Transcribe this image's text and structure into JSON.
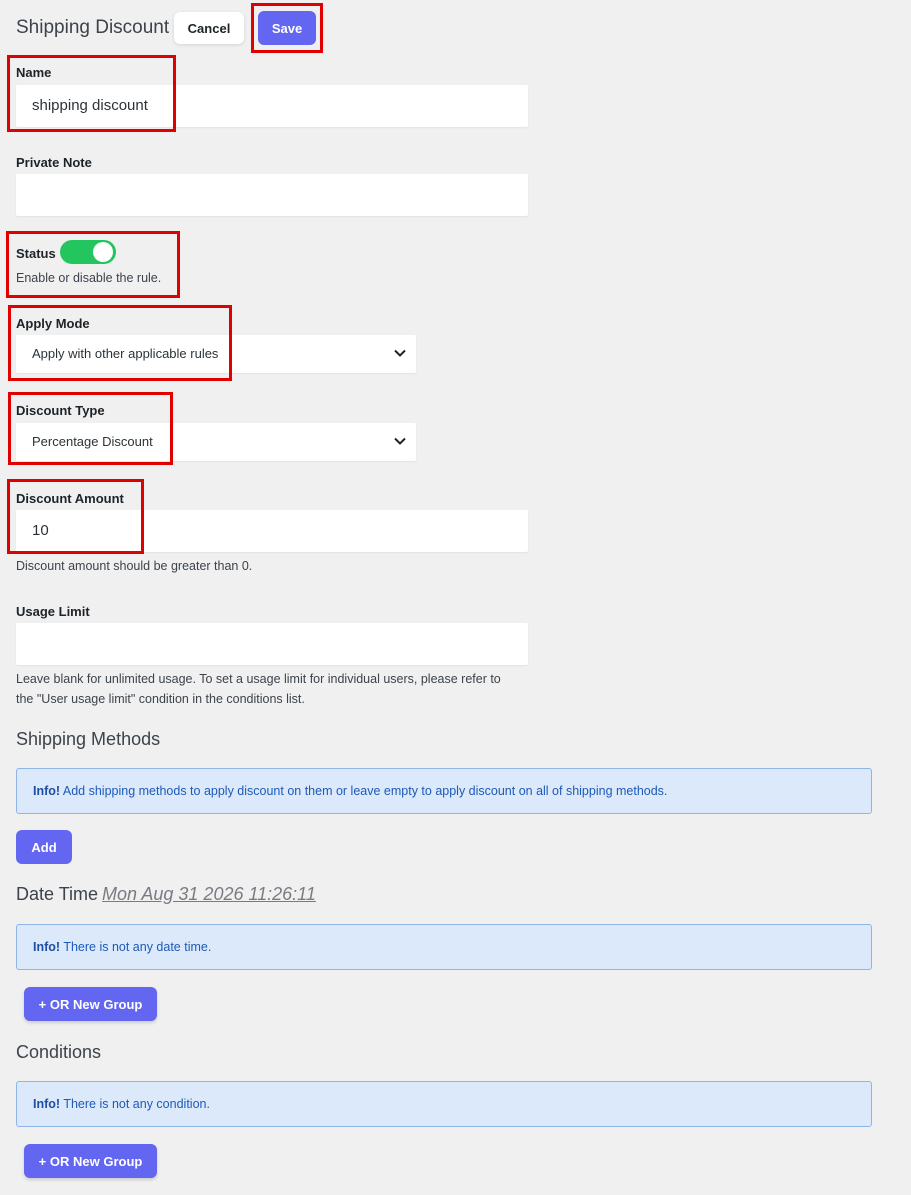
{
  "header": {
    "title": "Shipping Discount",
    "cancel_label": "Cancel",
    "save_label": "Save"
  },
  "name": {
    "label": "Name",
    "value": "shipping discount"
  },
  "private_note": {
    "label": "Private Note",
    "value": ""
  },
  "status": {
    "label": "Status",
    "enabled": true,
    "help": "Enable or disable the rule."
  },
  "apply_mode": {
    "label": "Apply Mode",
    "selected": "Apply with other applicable rules"
  },
  "discount_type": {
    "label": "Discount Type",
    "selected": "Percentage Discount"
  },
  "discount_amount": {
    "label": "Discount Amount",
    "value": "10",
    "help": "Discount amount should be greater than 0."
  },
  "usage_limit": {
    "label": "Usage Limit",
    "value": "",
    "help_line1": "Leave blank for unlimited usage. To set a usage limit for individual users, please refer to",
    "help_line2": "the \"User usage limit\" condition in the conditions list."
  },
  "shipping_methods": {
    "title": "Shipping Methods",
    "info_prefix": "Info!",
    "info_text": "Add shipping methods to apply discount on them or leave empty to apply discount on all of shipping methods.",
    "add_label": "Add"
  },
  "date_time": {
    "title": "Date Time",
    "current": "Mon Aug 31 2026 11:26:11",
    "info_prefix": "Info!",
    "info_text": "There is not any date time.",
    "group_label": "+ OR New Group"
  },
  "conditions": {
    "title": "Conditions",
    "info_prefix": "Info!",
    "info_text": "There is not any condition.",
    "group_label": "+ OR New Group"
  },
  "colors": {
    "accent": "#6366f1",
    "toggle_on": "#22c55e",
    "highlight": "#e00000",
    "info_bg": "#dbe9fb"
  }
}
